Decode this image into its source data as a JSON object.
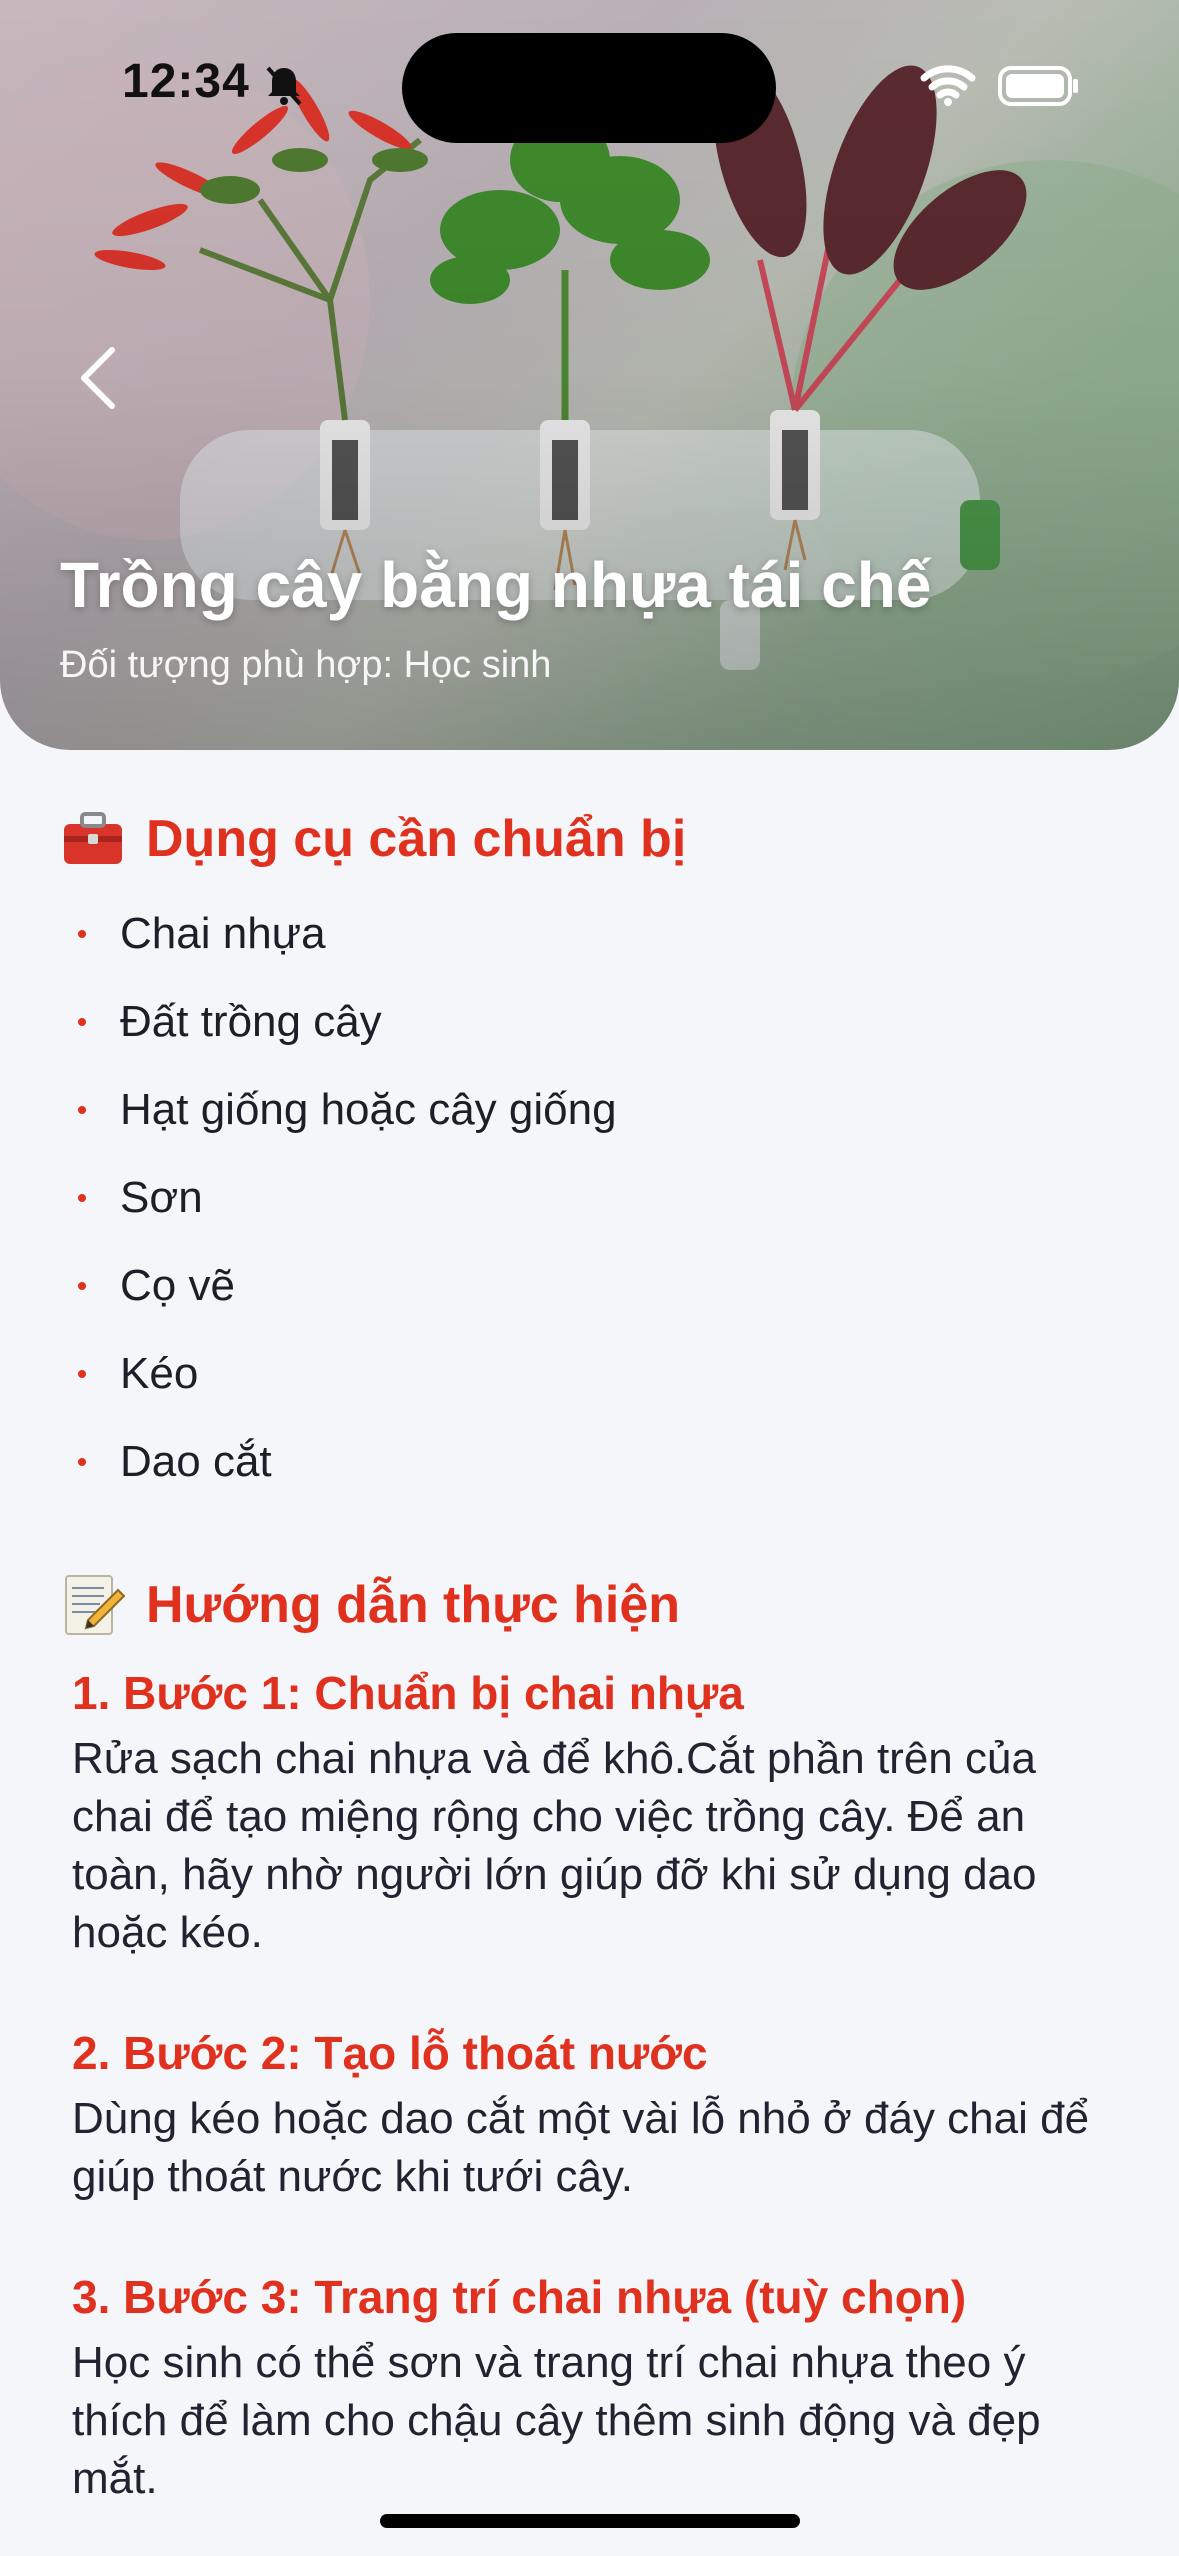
{
  "status_bar": {
    "time": "12:34",
    "icons": [
      "bell-slash-icon",
      "wifi-icon",
      "battery-icon"
    ]
  },
  "header": {
    "back_icon": "chevron-left-icon",
    "title": "Trồng cây bằng nhựa tái chế",
    "subtitle": "Đối tượng phù hợp: Học sinh"
  },
  "tools_section": {
    "icon": "toolbox-icon",
    "title": "Dụng cụ cần chuẩn bị",
    "items": [
      "Chai nhựa",
      "Đất trồng cây",
      "Hạt giống hoặc cây giống",
      "Sơn",
      "Cọ vẽ",
      "Kéo",
      "Dao cắt"
    ]
  },
  "steps_section": {
    "icon": "memo-icon",
    "title": "Hướng dẫn thực hiện",
    "steps": [
      {
        "title": "1. Bước 1: Chuẩn bị chai nhựa",
        "text": "Rửa sạch chai nhựa và để khô.Cắt phần trên của chai để tạo miệng rộng cho việc trồng cây. Để an toàn, hãy nhờ người lớn giúp đỡ khi sử dụng dao hoặc kéo."
      },
      {
        "title": "2. Bước 2: Tạo lỗ thoát nước",
        "text": "Dùng kéo hoặc dao cắt một vài lỗ nhỏ ở đáy chai để giúp thoát nước khi tưới cây."
      },
      {
        "title": "3. Bước 3: Trang trí chai nhựa (tuỳ chọn)",
        "text": "Học sinh có thể sơn và trang trí chai nhựa theo ý thích để làm cho chậu cây thêm sinh động và đẹp mắt."
      }
    ]
  },
  "colors": {
    "accent": "#e0301e",
    "background": "#f5f6fa",
    "text": "#1e1e28"
  }
}
